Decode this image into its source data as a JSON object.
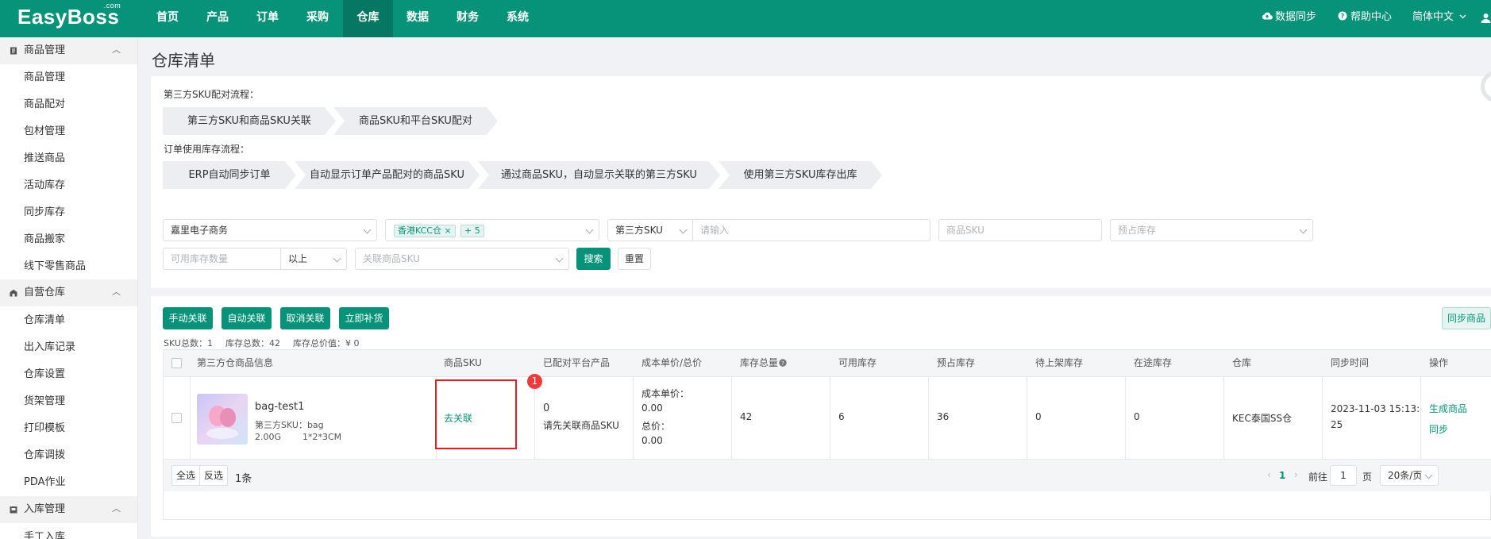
{
  "brand": {
    "logo": "EasyBoss",
    "logo_sup": ".com"
  },
  "topnav": {
    "items": [
      "首页",
      "产品",
      "订单",
      "采购",
      "仓库",
      "数据",
      "财务",
      "系统"
    ],
    "active": "仓库",
    "sync": "数据同步",
    "help": "帮助中心",
    "lang": "简体中文"
  },
  "sidebar": {
    "groups": [
      {
        "label": "商品管理",
        "items": [
          "商品管理",
          "商品配对",
          "包材管理",
          "推送商品",
          "活动库存",
          "同步库存",
          "商品搬家",
          "线下零售商品"
        ]
      },
      {
        "label": "自营仓库",
        "items": [
          "仓库清单",
          "出入库记录",
          "仓库设置",
          "货架管理",
          "打印模板",
          "仓库调拨",
          "PDA作业"
        ]
      },
      {
        "label": "入库管理",
        "items": [
          "手工入库"
        ]
      }
    ]
  },
  "page": {
    "title": "仓库清单"
  },
  "flows": {
    "flow1_label": "第三方SKU配对流程：",
    "flow1_steps": [
      "第三方SKU和商品SKU关联",
      "商品SKU和平台SKU配对"
    ],
    "flow2_label": "订单使用库存流程：",
    "flow2_steps": [
      "ERP自动同步订单",
      "自动显示订单产品配对的商品SKU",
      "通过商品SKU，自动显示关联的第三方SKU",
      "使用第三方SKU库存出库"
    ]
  },
  "filters": {
    "company": "嘉里电子商务",
    "warehouse_tag": "香港KCC仓",
    "warehouse_more": "+ 5",
    "sku_type": "第三方SKU",
    "keyword_placeholder": "请输入",
    "product_sku_placeholder": "商品SKU",
    "reserved_placeholder": "预占库存",
    "available_qty_placeholder": "可用库存数量",
    "compare": "以上",
    "linked_sku_placeholder": "关联商品SKU",
    "search": "搜索",
    "reset": "重置"
  },
  "actions": {
    "manual_link": "手动关联",
    "auto_link": "自动关联",
    "cancel_link": "取消关联",
    "restock": "立即补货",
    "sync_products": "同步商品"
  },
  "stats": {
    "sku_total_label": "SKU总数：",
    "sku_total": "1",
    "stock_total_label": "库存总数：",
    "stock_total": "42",
    "stock_value_label": "库存总价值：",
    "stock_value": "¥ 0"
  },
  "table": {
    "headers": [
      "第三方仓商品信息",
      "商品SKU",
      "已配对平台产品",
      "成本单价/总价",
      "库存总量",
      "可用库存",
      "预占库存",
      "待上架库存",
      "在途库存",
      "仓库",
      "同步时间",
      "操作"
    ],
    "row": {
      "name": "bag-test1",
      "third_sku": "第三方SKU：bag",
      "weight": "2.00G",
      "size": "1*2*3CM",
      "link_action": "去关联",
      "badge": "1",
      "paired_count": "0",
      "paired_hint": "请先关联商品SKU",
      "unit_cost_label": "成本单价：",
      "unit_cost": "0.00",
      "total_label": "总价：",
      "total": "0.00",
      "stock_total": "42",
      "available": "6",
      "reserved": "36",
      "pending_shelf": "0",
      "in_transit": "0",
      "warehouse": "KEC泰国SS仓",
      "sync_time_1": "2023-11-03 15:13:",
      "sync_time_2": "25",
      "op1": "生成商品",
      "op2": "同步"
    }
  },
  "footer": {
    "select_all": "全选",
    "invert": "反选",
    "count": "1条",
    "page": "1",
    "goto_label": "前往",
    "goto_value": "1",
    "page_unit": "页",
    "page_size": "20条/页"
  },
  "colors": {
    "primary": "#079379",
    "highlight": "#e02020",
    "badge": "#f03a3a"
  }
}
